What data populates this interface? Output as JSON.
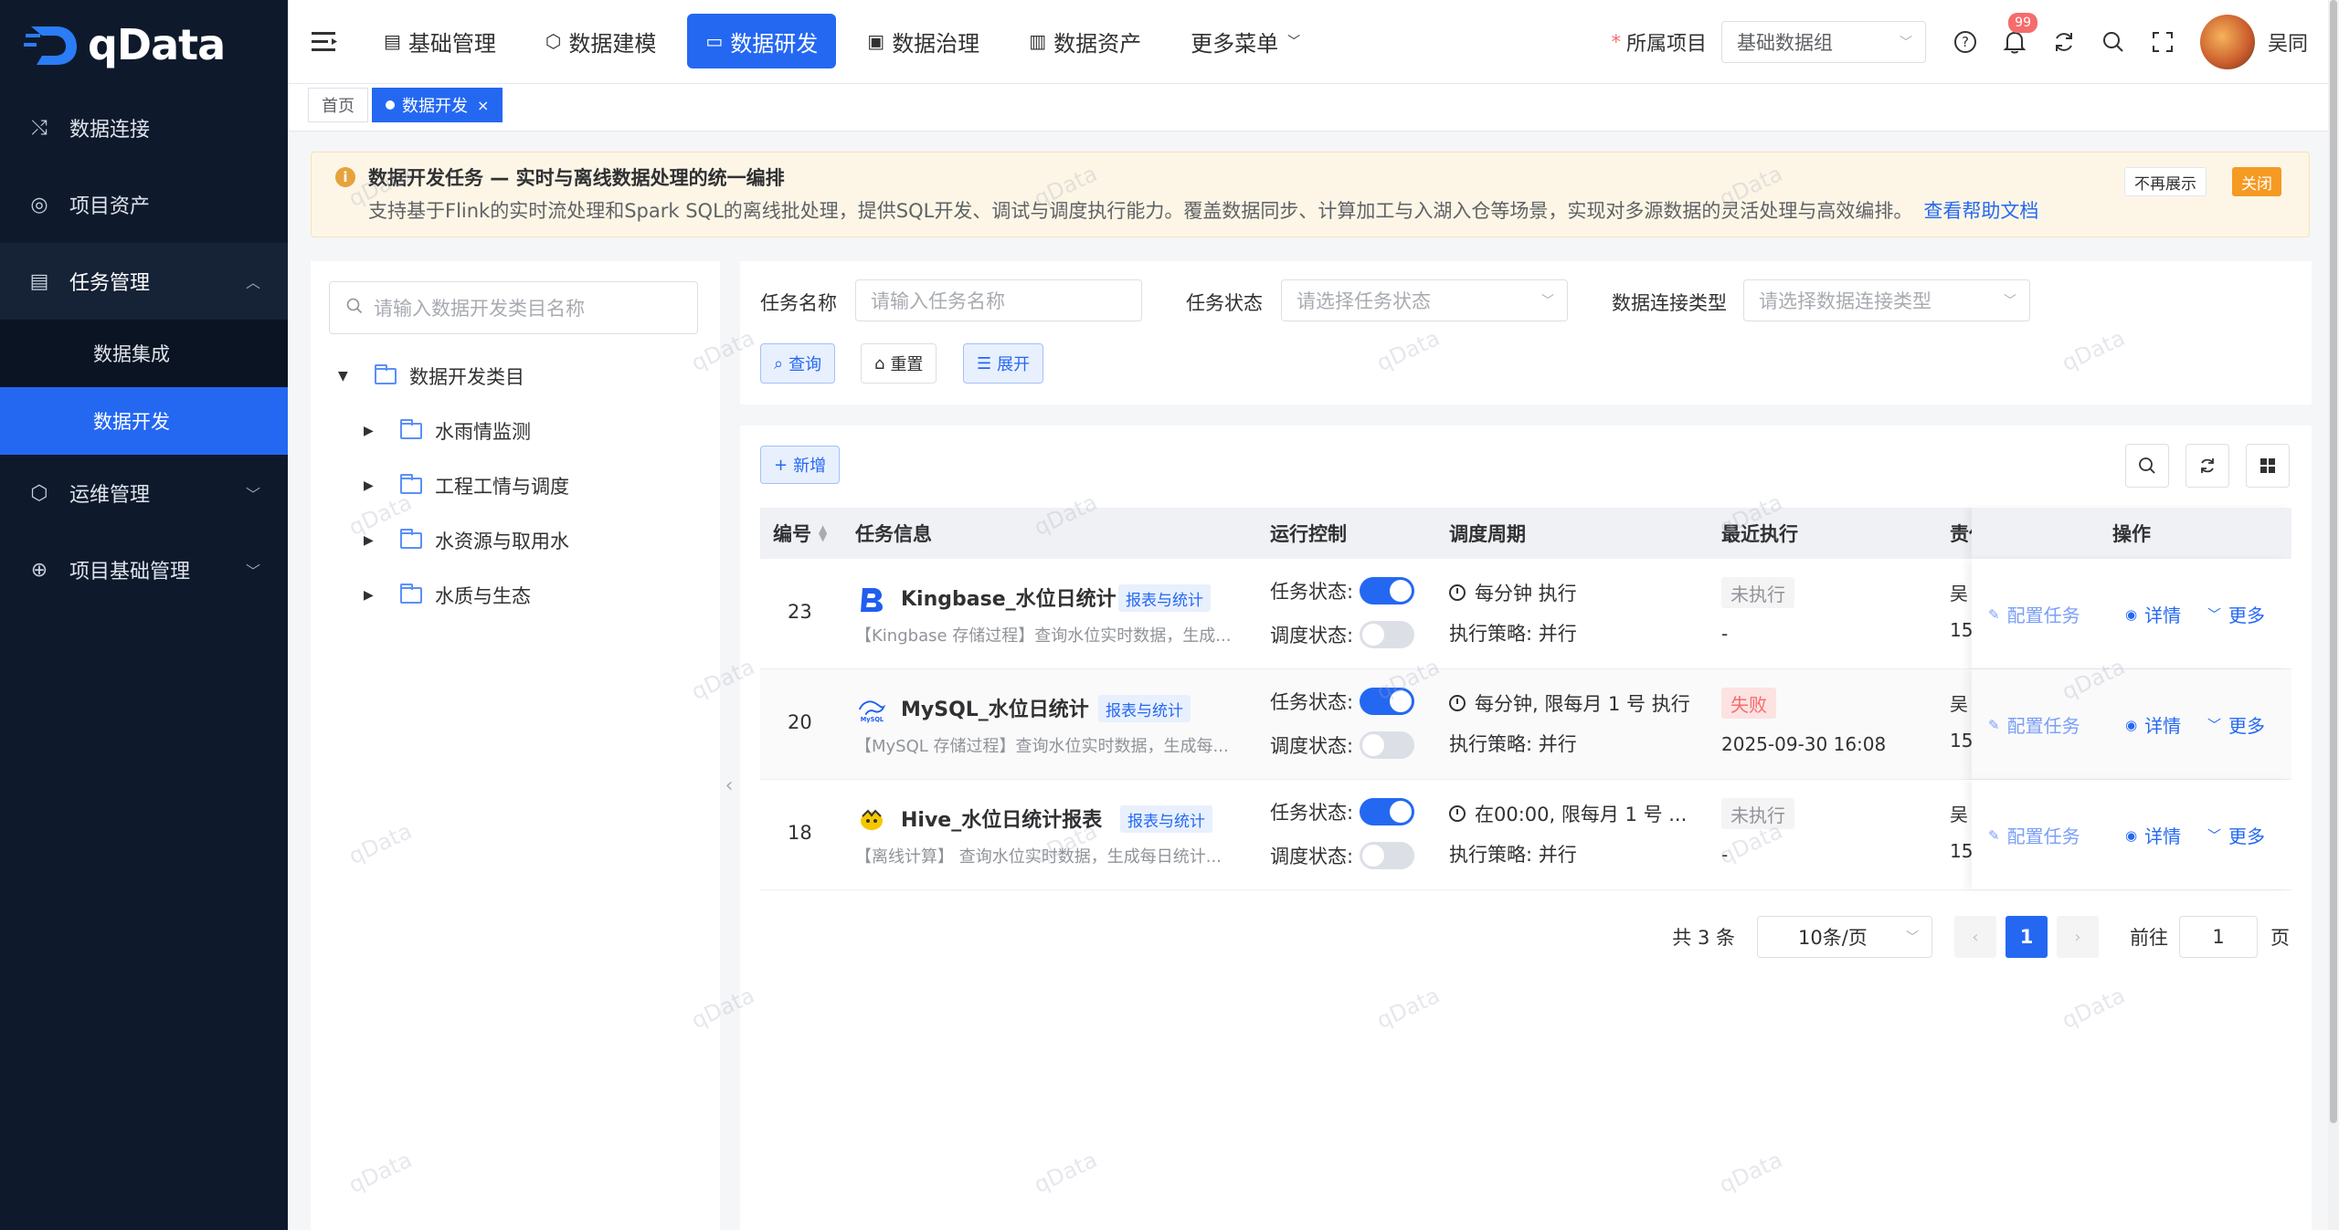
{
  "app": {
    "brand": "qData",
    "accent": "#2468f2",
    "sidebar_bg": "#0e1a2c"
  },
  "sidebar": {
    "items": [
      {
        "label": "数据连接",
        "icon": "shuffle-icon"
      },
      {
        "label": "项目资产",
        "icon": "target-icon"
      },
      {
        "label": "任务管理",
        "icon": "document-icon",
        "expanded": true,
        "children": [
          {
            "label": "数据集成"
          },
          {
            "label": "数据开发",
            "active": true
          }
        ]
      },
      {
        "label": "运维管理",
        "icon": "cube-icon"
      },
      {
        "label": "项目基础管理",
        "icon": "globe-icon"
      }
    ]
  },
  "header": {
    "nav": [
      {
        "label": "基础管理",
        "icon": "document-icon"
      },
      {
        "label": "数据建模",
        "icon": "cube-icon"
      },
      {
        "label": "数据研发",
        "icon": "window-icon",
        "active": true
      },
      {
        "label": "数据治理",
        "icon": "shield-icon"
      },
      {
        "label": "数据资产",
        "icon": "folder-icon"
      },
      {
        "label": "更多菜单",
        "dropdown": true
      }
    ],
    "project_label": "所属项目",
    "project_value": "基础数据组",
    "notification_count": "99",
    "username": "吴同"
  },
  "tabs": [
    {
      "label": "首页"
    },
    {
      "label": "数据开发",
      "active": true
    }
  ],
  "notice": {
    "title": "数据开发任务 — 实时与离线数据处理的统一编排",
    "desc": "支持基于Flink的实时流处理和Spark SQL的离线批处理，提供SQL开发、调试与调度执行能力。覆盖数据同步、计算加工与入湖入仓等场景，实现对多源数据的灵活处理与高效编排。",
    "link": "查看帮助文档",
    "dismiss_label": "不再展示",
    "close_label": "关闭"
  },
  "tree": {
    "search_placeholder": "请输入数据开发类目名称",
    "root": "数据开发类目",
    "children": [
      "水雨情监测",
      "工程工情与调度",
      "水资源与取用水",
      "水质与生态"
    ]
  },
  "filter": {
    "task_name_label": "任务名称",
    "task_name_placeholder": "请输入任务名称",
    "task_status_label": "任务状态",
    "task_status_placeholder": "请选择任务状态",
    "conn_type_label": "数据连接类型",
    "conn_type_placeholder": "请选择数据连接类型",
    "query_label": "查询",
    "reset_label": "重置",
    "expand_label": "展开"
  },
  "table": {
    "add_label": "新增",
    "columns": {
      "id": "编号",
      "info": "任务信息",
      "control": "运行控制",
      "schedule": "调度周期",
      "last_run": "最近执行",
      "owner": "责任",
      "ops": "操作"
    },
    "task_status_label": "任务状态:",
    "schedule_status_label": "调度状态:",
    "policy_label": "执行策略: 并行",
    "op_config": "配置任务",
    "op_detail": "详情",
    "op_more": "更多",
    "rows": [
      {
        "id": "23",
        "name": "Kingbase_水位日统计",
        "tag": "报表与统计",
        "desc": "【Kingbase 存储过程】查询水位实时数据，生成...",
        "logo": "kingbase-logo-icon",
        "task_on": true,
        "sched_on": false,
        "schedule": "每分钟 执行",
        "last_status": "未执行",
        "last_status_kind": "gray",
        "last_time": "-",
        "owner": "吴",
        "owner_sub": "15"
      },
      {
        "id": "20",
        "name": "MySQL_水位日统计",
        "tag": "报表与统计",
        "desc": "【MySQL 存储过程】查询水位实时数据，生成每...",
        "logo": "mysql-logo-icon",
        "task_on": true,
        "sched_on": false,
        "schedule": "每分钟, 限每月 1 号 执行",
        "last_status": "失败",
        "last_status_kind": "red",
        "last_time": "2025-09-30 16:08",
        "owner": "吴",
        "owner_sub": "15"
      },
      {
        "id": "18",
        "name": "Hive_水位日统计报表",
        "tag": "报表与统计",
        "desc": "【离线计算】 查询水位实时数据，生成每日统计...",
        "logo": "hive-logo-icon",
        "task_on": true,
        "sched_on": false,
        "schedule": "在00:00, 限每月 1 号 ...",
        "last_status": "未执行",
        "last_status_kind": "gray",
        "last_time": "-",
        "owner": "吴",
        "owner_sub": "15"
      }
    ]
  },
  "pager": {
    "total": "共 3 条",
    "size": "10条/页",
    "current": "1",
    "goto_label": "前往",
    "goto_value": "1",
    "unit": "页"
  },
  "watermark": "qData"
}
